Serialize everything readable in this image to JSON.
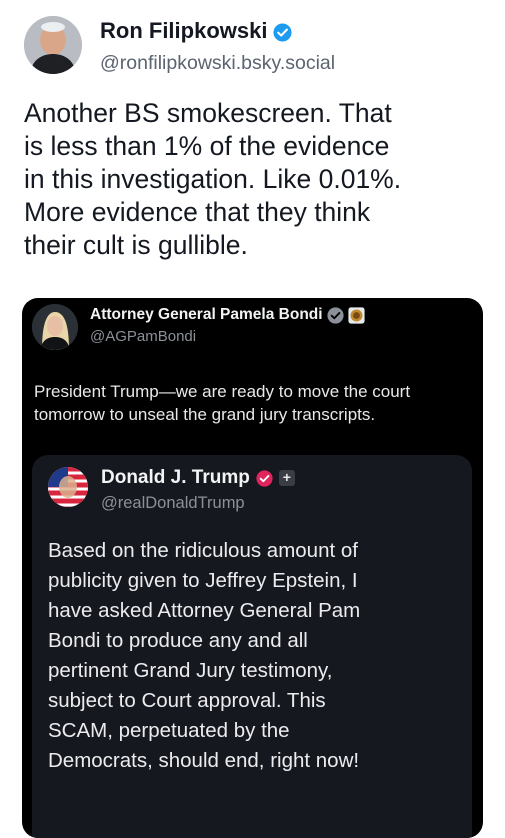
{
  "post": {
    "author": {
      "name": "Ron Filipkowski",
      "handle": "@ronfilipkowski.bsky.social",
      "verified_color": "#1d9bf0"
    },
    "text_lines": [
      "Another BS smokescreen. That",
      "is less than 1% of the evidence",
      "in this investigation. Like 0.01%.",
      "More evidence that they think",
      "their cult is gullible."
    ]
  },
  "quoted_post": {
    "author": {
      "name": "Attorney General Pamela Bondi",
      "handle": "@AGPamBondi",
      "badge_icons": [
        "verified-gray-icon",
        "government-seal-icon"
      ]
    },
    "text_lines": [
      "President Trump—we are ready to move the court",
      "tomorrow to unseal the grand jury transcripts."
    ],
    "inner_post": {
      "author": {
        "name": "Donald J. Trump",
        "handle": "@realDonaldTrump",
        "badge_icons": [
          "verified-pink-icon",
          "plus-badge-icon"
        ],
        "plus_badge_label": "+"
      },
      "text_lines": [
        "Based on the ridiculous amount of",
        "publicity given to Jeffrey Epstein, I",
        "have asked Attorney General Pam",
        "Bondi to produce any and all",
        "pertinent Grand Jury testimony,",
        "subject to Court approval. This",
        "SCAM, perpetuated by the",
        "Democrats, should end, right now!"
      ]
    }
  },
  "colors": {
    "background": "#ffffff",
    "quote_card": "#000000",
    "inner_card": "#16181f",
    "verified_pink": "#e0245e"
  }
}
